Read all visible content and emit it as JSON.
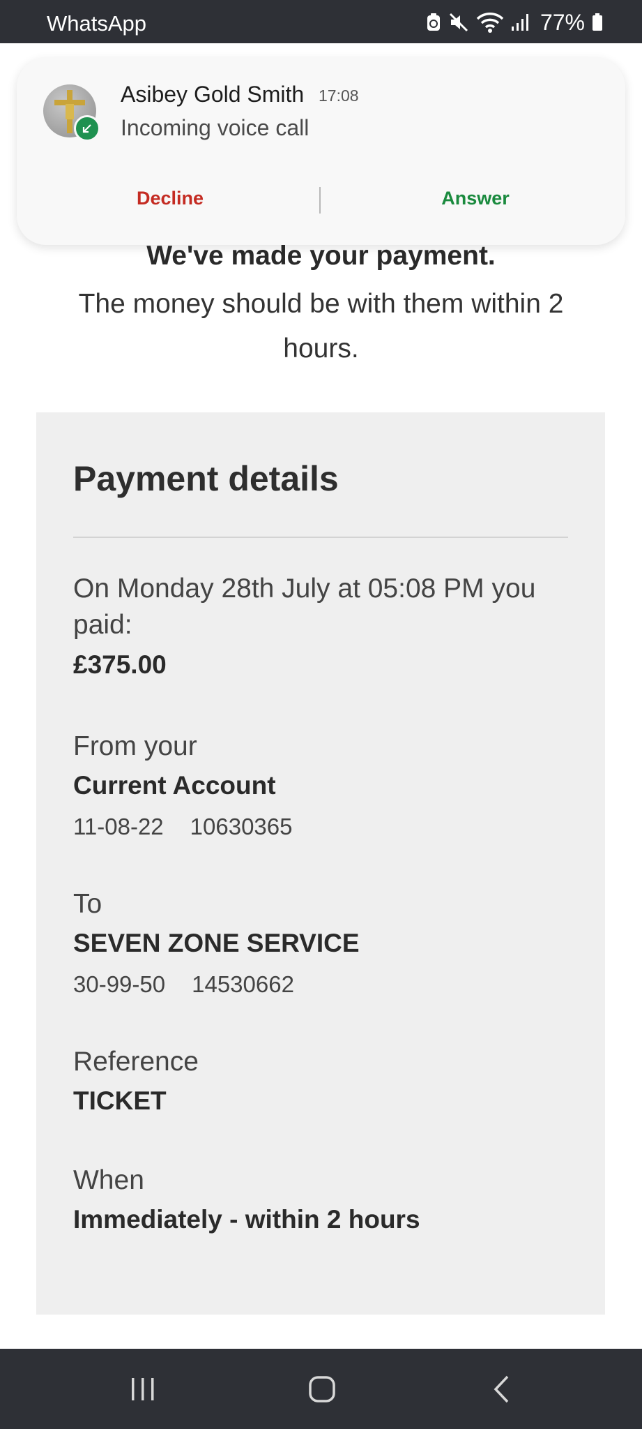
{
  "status_bar": {
    "app_name": "WhatsApp",
    "battery": "77%",
    "icons": [
      "screen-recorder-icon",
      "mute-icon",
      "wifi-icon",
      "signal-icon",
      "battery-icon"
    ]
  },
  "notification": {
    "caller": "Asibey Gold Smith",
    "time": "17:08",
    "status": "Incoming voice call",
    "decline_label": "Decline",
    "answer_label": "Answer",
    "decline_color": "#c42b22",
    "answer_color": "#1a8a3e"
  },
  "confirmation": {
    "title": "We've made your payment.",
    "subtitle": "The money should be with them within 2 hours."
  },
  "payment": {
    "heading": "Payment details",
    "paid_text": "On Monday 28th July at 05:08 PM you paid:",
    "amount": "£375.00",
    "from_label": "From your",
    "from_account": "Current Account",
    "from_sort_code": "11-08-22",
    "from_account_number": "10630365",
    "to_label": "To",
    "to_name": "SEVEN ZONE SERVICE",
    "to_sort_code": "30-99-50",
    "to_account_number": "14530662",
    "reference_label": "Reference",
    "reference": "TICKET",
    "when_label": "When",
    "when": "Immediately - within 2 hours"
  },
  "nav": {
    "icons": [
      "recent-apps-icon",
      "home-icon",
      "back-icon"
    ]
  }
}
